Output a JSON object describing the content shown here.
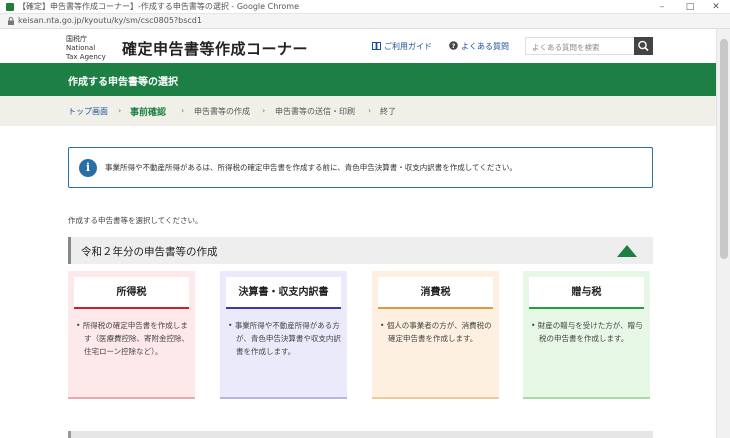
{
  "browser": {
    "title": "【確定】申告書等作成コーナー】-作成する申告書等の選択 - Google Chrome",
    "url": "keisan.nta.go.jp/kyoutu/ky/sm/csc0805?bscd1"
  },
  "header": {
    "logo": "国税庁 National Tax Agency",
    "site_title": "確定申告書等作成コーナー",
    "guide_label": "ご利用ガイド",
    "faq_label": "よくある質問",
    "search_placeholder": "よくある質問を検索"
  },
  "page": {
    "title": "作成する申告書等の選択"
  },
  "breadcrumb": {
    "items": [
      "トップ画面",
      "事前確認",
      "申告書等の作成",
      "申告書等の送信・印刷",
      "終了"
    ],
    "current_index": 1
  },
  "info": {
    "text": "事業所得や不動産所得があるは、所得税の確定申告書を作成する前に、青色申告決算書・収支内訳書を作成してください。"
  },
  "prompt": "作成する申告書等を選択してください。",
  "section": {
    "title": "令和２年分の申告書等の作成"
  },
  "cards": [
    {
      "title": "所得税",
      "text": "所得税の確定申告書を作成します（医療費控除、寄附金控除、住宅ローン控除など）。"
    },
    {
      "title": "決算書・収支内訳書",
      "text": "事業所得や不動産所得がある方が、青色申告決算書や収支内訳書を作成します。"
    },
    {
      "title": "消費税",
      "text": "個人の事業者の方が、消費税の確定申告書を作成します。"
    },
    {
      "title": "贈与税",
      "text": "財産の贈与を受けた方が、贈与税の申告書を作成します。"
    }
  ],
  "colors": {
    "brand_green": "#1e7f44",
    "info_blue": "#2a6ea6"
  }
}
